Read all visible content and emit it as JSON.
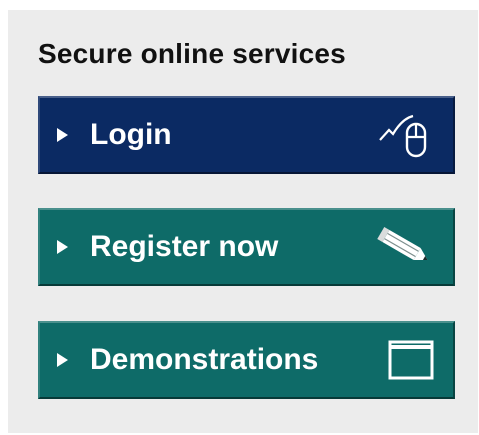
{
  "panel": {
    "title": "Secure online services"
  },
  "buttons": [
    {
      "label": "Login",
      "icon": "mouse-icon",
      "color": "#0b2a63"
    },
    {
      "label": "Register now",
      "icon": "pencil-icon",
      "color": "#0e6b68"
    },
    {
      "label": "Demonstrations",
      "icon": "window-icon",
      "color": "#0e6b68"
    }
  ],
  "colors": {
    "panel_bg": "#ececec",
    "login_bg": "#0b2a63",
    "teal_bg": "#0e6b68",
    "text_on_button": "#ffffff"
  }
}
